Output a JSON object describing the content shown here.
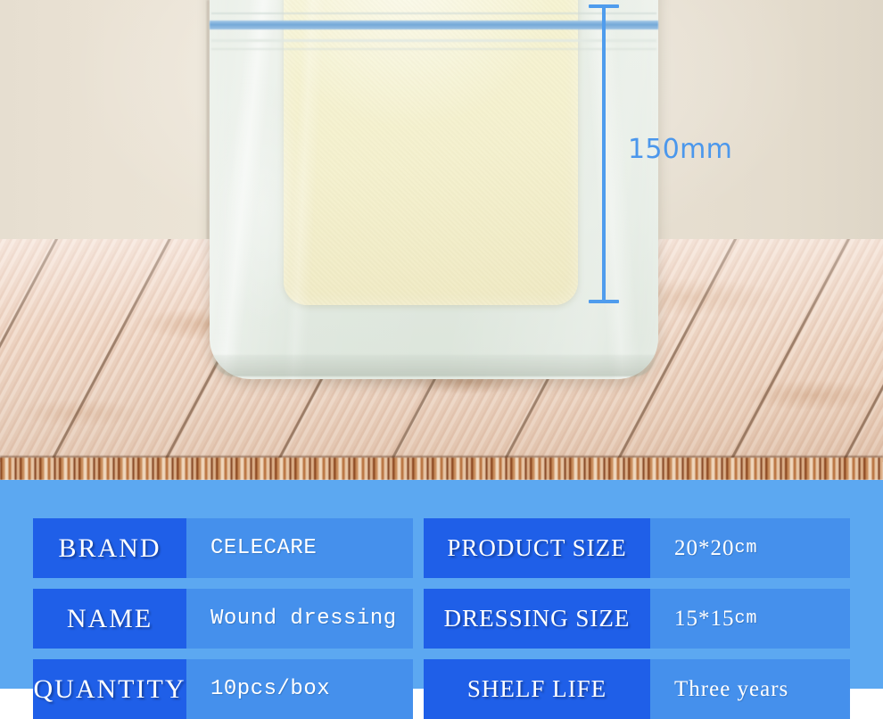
{
  "scene": {
    "product": {
      "bag_name": "sterile-package-bag",
      "pad_name": "foam-wound-dressing-pad",
      "bag_color": "#e4ebe2",
      "pad_color": "#f6f3d2",
      "zip_color": "#74a8d8"
    },
    "background": {
      "wall_color": "#e9e1d3",
      "table_color": "#efd9c9",
      "table_edge_color": "#b8723f"
    },
    "dimension_callout": {
      "label": "150mm",
      "color": "#4b97ec",
      "orientation": "vertical"
    }
  },
  "spec": {
    "panel_color": "#5ca8f1",
    "label_cell_color": "#1f5fe8",
    "value_cell_color": "#4590ec",
    "rows": [
      {
        "left": {
          "label": "BRAND",
          "value": "CELECARE",
          "unit": ""
        },
        "right": {
          "label": "PRODUCT SIZE",
          "value": "20*20",
          "unit": "cm"
        }
      },
      {
        "left": {
          "label": "NAME",
          "value": "Wound dressing",
          "unit": ""
        },
        "right": {
          "label": "DRESSING SIZE",
          "value": "15*15",
          "unit": "cm"
        }
      },
      {
        "left": {
          "label": "QUANTITY",
          "value": "10pcs/box",
          "unit": ""
        },
        "right": {
          "label": "SHELF LIFE",
          "value": "Three years",
          "unit": ""
        }
      }
    ]
  }
}
